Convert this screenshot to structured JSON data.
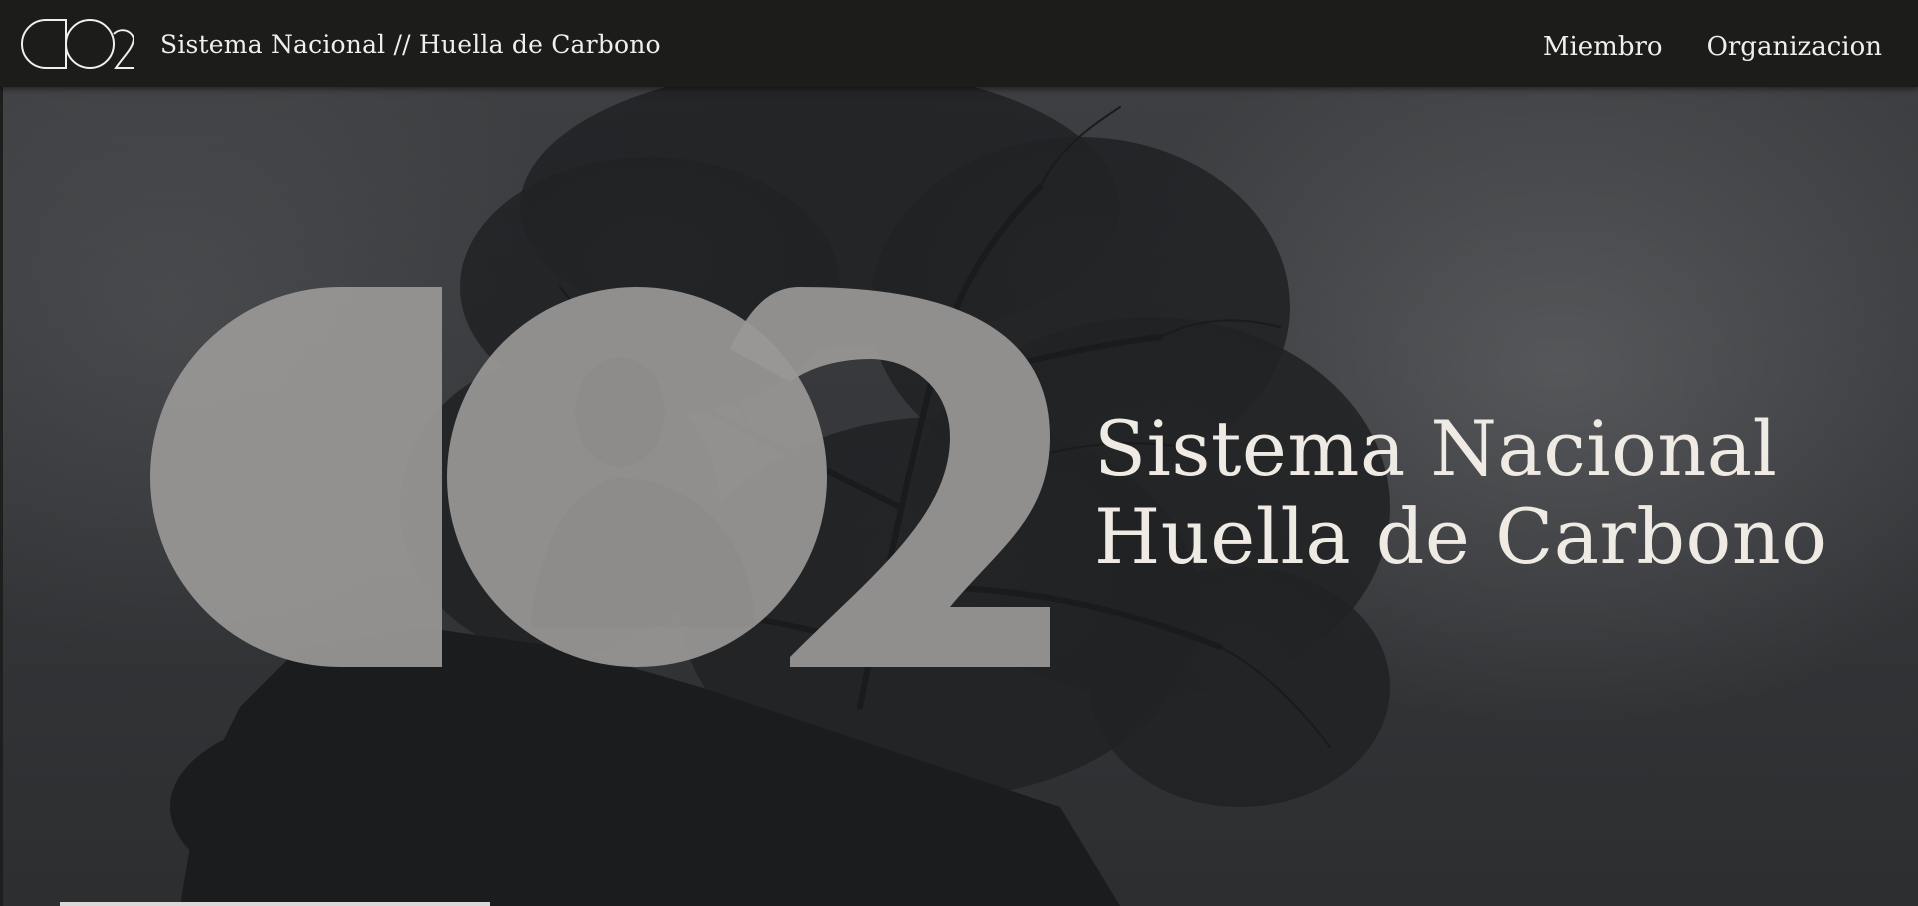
{
  "navbar": {
    "logo_icon": "co2-outline-logo-icon",
    "brand_title": "Sistema Nacional // Huella de Carbono",
    "links": [
      {
        "label": "Miembro"
      },
      {
        "label": "Organizacion"
      }
    ]
  },
  "hero": {
    "logo_icon": "co2-large-logo-icon",
    "title_line1": "Sistema Nacional",
    "title_line2": "Huella de Carbono"
  },
  "colors": {
    "navbar_bg": "#1c1c1a",
    "text": "#f1efe9",
    "logo_fill": "#9a9896",
    "hero_bg": "#35373a"
  }
}
